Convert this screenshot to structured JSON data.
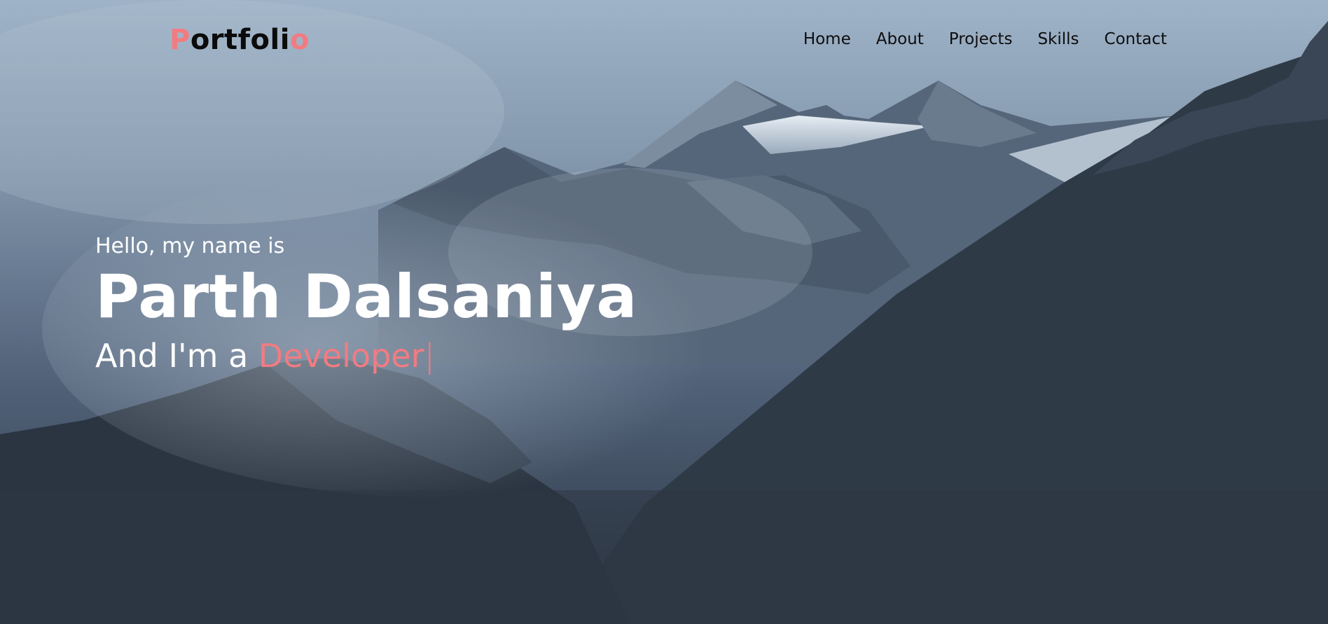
{
  "brand": {
    "logo_first": "P",
    "logo_middle": "ortfoli",
    "logo_last": "o",
    "accent_color": "#f27b82"
  },
  "nav": {
    "items": [
      {
        "label": "Home"
      },
      {
        "label": "About"
      },
      {
        "label": "Projects"
      },
      {
        "label": "Skills"
      },
      {
        "label": "Contact"
      }
    ]
  },
  "hero": {
    "greeting": "Hello, my name is",
    "name": "Parth Dalsaniya",
    "role_prefix": "And I'm a",
    "role": "Developer",
    "cursor": "|",
    "background_image": "misty-mountain-landscape"
  }
}
